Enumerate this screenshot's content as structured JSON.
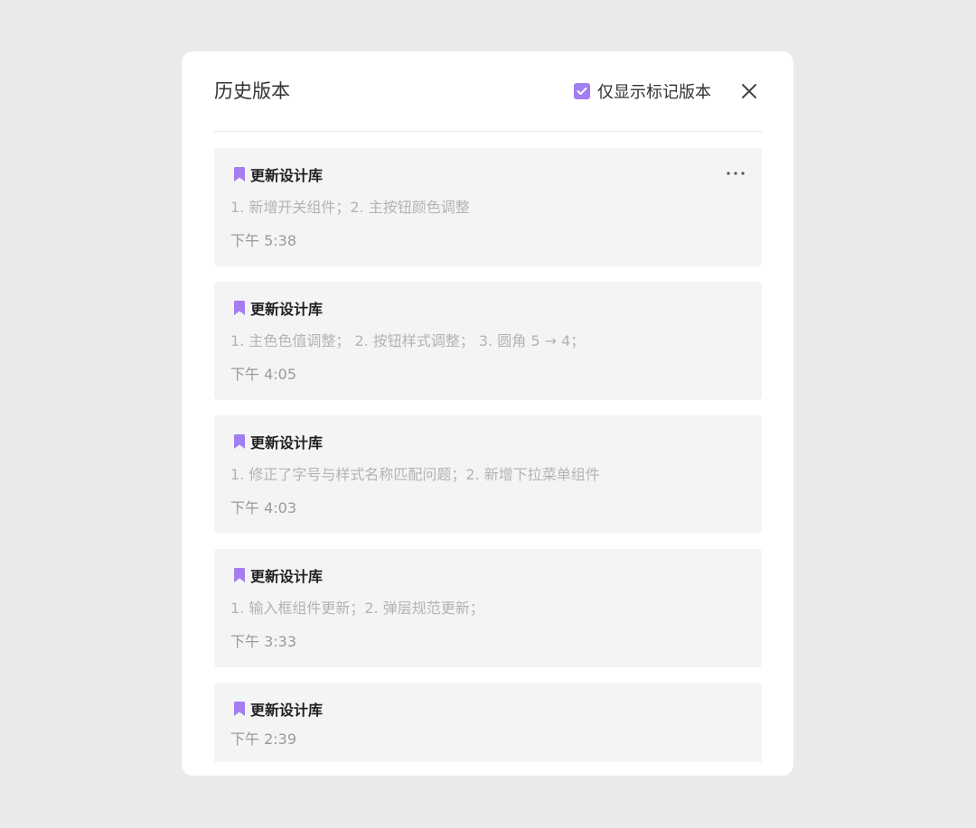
{
  "header": {
    "title": "历史版本",
    "filter_label": "仅显示标记版本",
    "filter_checked": true
  },
  "icons": {
    "checkbox": "check-icon",
    "close": "close-icon",
    "bookmark": "bookmark-icon",
    "more": "more-horizontal-icon"
  },
  "colors": {
    "accent": "#a37ef1",
    "page_bg": "#e9eaec",
    "card_bg": "#f4f4f4"
  },
  "versions": [
    {
      "title": "更新设计库",
      "desc": "1. 新增开关组件；2. 主按钮颜色调整",
      "time": "下午 5:38"
    },
    {
      "title": "更新设计库",
      "desc": "1. 主色色值调整；  2. 按钮样式调整；  3. 圆角 5 → 4；",
      "time": "下午 4:05"
    },
    {
      "title": "更新设计库",
      "desc": "1. 修正了字号与样式名称匹配问题；2. 新增下拉菜单组件",
      "time": "下午 4:03"
    },
    {
      "title": "更新设计库",
      "desc": "1. 输入框组件更新；2. 弹层规范更新；",
      "time": "下午 3:33"
    },
    {
      "title": "更新设计库",
      "desc": "",
      "time": "下午 2:39"
    }
  ]
}
